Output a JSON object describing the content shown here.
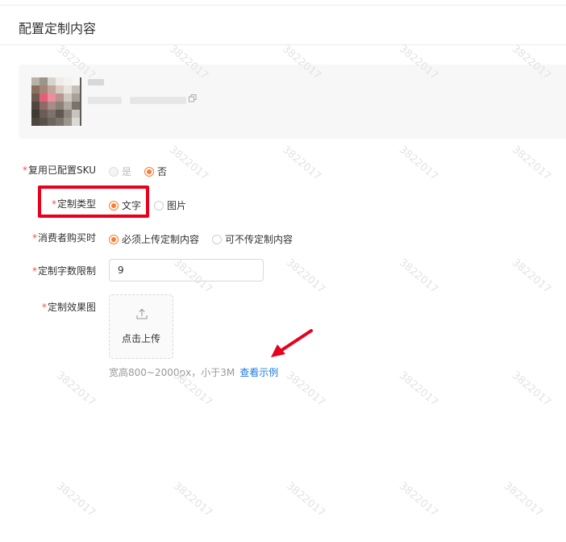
{
  "header": {
    "title": "配置定制内容"
  },
  "watermark": "3822017",
  "form": {
    "reuse_sku": {
      "label": "复用已配置SKU",
      "options": [
        {
          "label": "是",
          "state": "disabled"
        },
        {
          "label": "否",
          "state": "checked"
        }
      ]
    },
    "custom_type": {
      "label": "定制类型",
      "options": [
        {
          "label": "文字",
          "state": "checked"
        },
        {
          "label": "图片",
          "state": "unchecked"
        }
      ]
    },
    "consumer_purchase": {
      "label": "消费者购买时",
      "options": [
        {
          "label": "必须上传定制内容",
          "state": "checked"
        },
        {
          "label": "可不传定制内容",
          "state": "unchecked"
        }
      ]
    },
    "char_limit": {
      "label": "定制字数限制",
      "value": "9"
    },
    "effect_image": {
      "label": "定制效果图",
      "upload_label": "点击上传",
      "hint": "宽高800~2000px，小于3M",
      "example_link": "查看示例"
    }
  },
  "colors": {
    "accent": "#ff7a2e",
    "required": "#ff4d4f",
    "link": "#1f7ae0",
    "annotation": "#e8001c"
  }
}
